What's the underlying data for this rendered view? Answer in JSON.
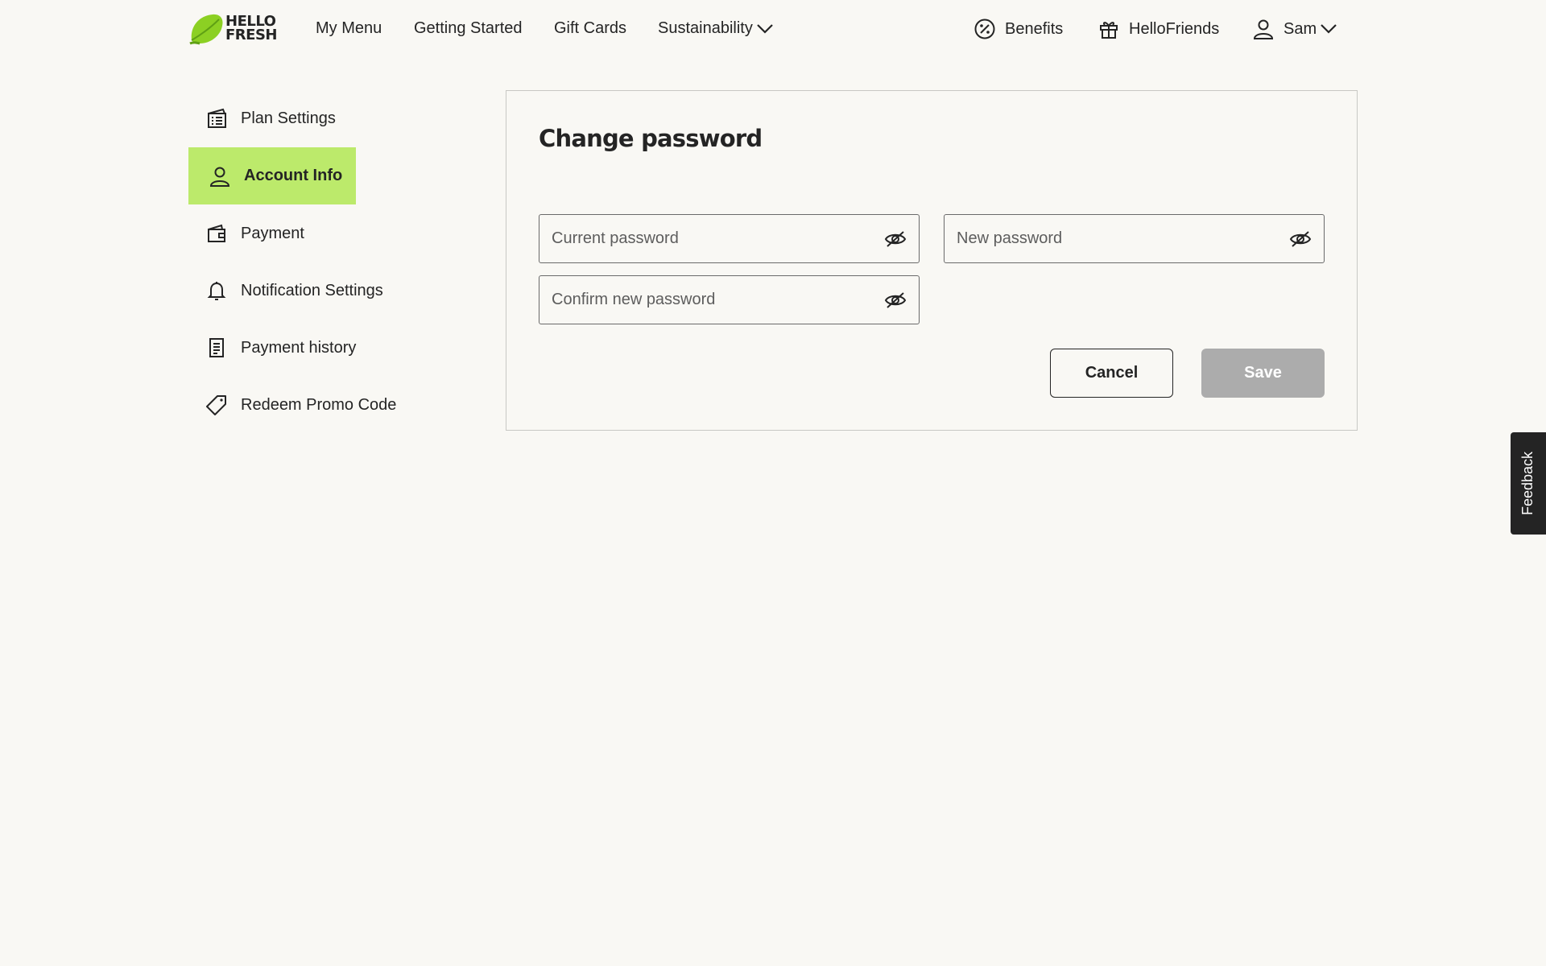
{
  "header": {
    "logo": {
      "line1": "HELLO",
      "line2": "FRESH",
      "brand_color": "#8cd023"
    },
    "nav": [
      {
        "label": "My Menu"
      },
      {
        "label": "Getting Started"
      },
      {
        "label": "Gift Cards"
      },
      {
        "label": "Sustainability"
      }
    ],
    "benefits_label": "Benefits",
    "hellofriends_label": "HelloFriends",
    "user_name": "Sam"
  },
  "sidebar": {
    "active_color": "#bcea6b",
    "items": [
      {
        "label": "Plan Settings",
        "icon": "plan-icon"
      },
      {
        "label": "Account Info",
        "icon": "user-icon",
        "active": true
      },
      {
        "label": "Payment",
        "icon": "wallet-icon"
      },
      {
        "label": "Notification Settings",
        "icon": "bell-icon"
      },
      {
        "label": "Payment history",
        "icon": "receipt-icon"
      },
      {
        "label": "Redeem Promo Code",
        "icon": "tag-icon"
      }
    ]
  },
  "form": {
    "title": "Change password",
    "current_password": {
      "placeholder": "Current password",
      "value": ""
    },
    "new_password": {
      "placeholder": "New password",
      "value": ""
    },
    "confirm_password": {
      "placeholder": "Confirm new password",
      "value": ""
    },
    "cancel_label": "Cancel",
    "save_label": "Save",
    "save_disabled_color": "#acacac"
  },
  "feedback_label": "Feedback"
}
